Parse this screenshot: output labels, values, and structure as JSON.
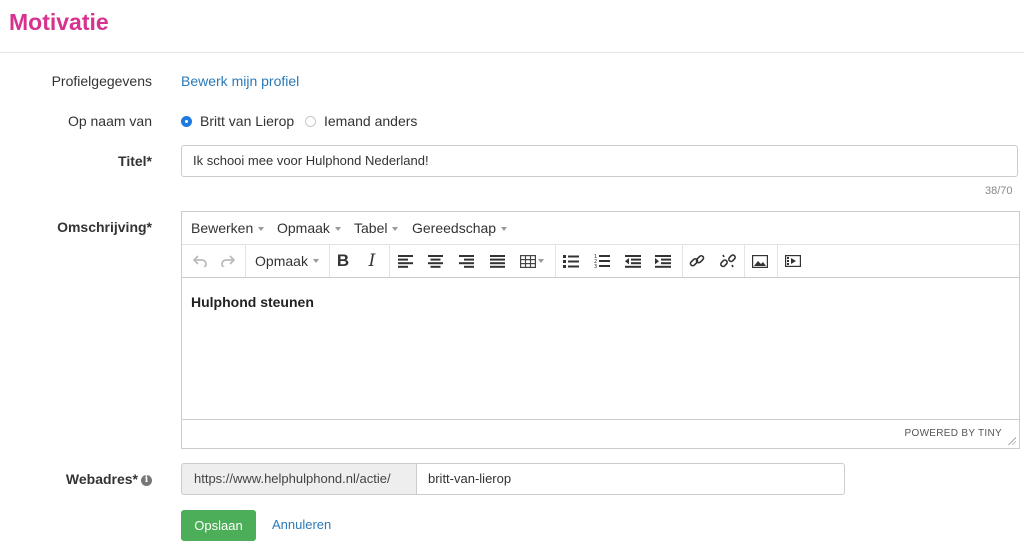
{
  "page": {
    "title": "Motivatie"
  },
  "profile": {
    "label": "Profielgegevens",
    "link": "Bewerk mijn profiel"
  },
  "on_behalf": {
    "label": "Op naam van",
    "options": [
      {
        "label": "Britt van Lierop",
        "selected": true
      },
      {
        "label": "Iemand anders",
        "selected": false
      }
    ]
  },
  "title_field": {
    "label": "Titel*",
    "value": "Ik schooi mee voor Hulphond Nederland!",
    "counter": "38/70"
  },
  "description": {
    "label": "Omschrijving*",
    "menu": [
      "Bewerken",
      "Opmaak",
      "Tabel",
      "Gereedschap"
    ],
    "format_dropdown": "Opmaak",
    "content": "Hulphond steunen",
    "powered_by": "POWERED BY TINY"
  },
  "webaddress": {
    "label": "Webadres*",
    "info_icon": "i",
    "prefix": "https://www.helphulphond.nl/actie/",
    "slug": "britt-van-lierop"
  },
  "actions": {
    "save": "Opslaan",
    "cancel": "Annuleren"
  },
  "colors": {
    "accent": "#d6338f",
    "link": "#2a7ab8",
    "save": "#4cae58",
    "radio": "#1f7ae0"
  }
}
